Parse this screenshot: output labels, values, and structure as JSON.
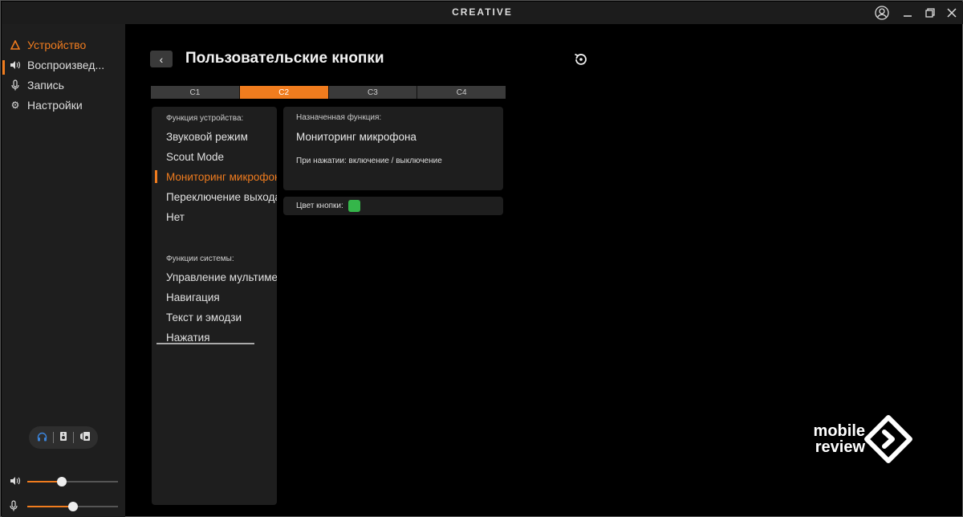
{
  "window": {
    "brand": "CREATIVE"
  },
  "sidebar": {
    "items": [
      {
        "label": "Устройство",
        "icon": "triangle-icon",
        "active": true
      },
      {
        "label": "Воспроизвед...",
        "icon": "speaker-icon",
        "active": false
      },
      {
        "label": "Запись",
        "icon": "microphone-icon",
        "active": false
      },
      {
        "label": "Настройки",
        "icon": "gear-icon",
        "active": false
      }
    ],
    "output_devices": [
      "headphones-icon",
      "speaker-box-icon",
      "speaker-box-alt-icon"
    ],
    "volume": {
      "output_level": 0.38,
      "mic_level": 0.5
    }
  },
  "main": {
    "title": "Пользовательские кнопки",
    "tabs": [
      {
        "label": "C1",
        "active": false
      },
      {
        "label": "C2",
        "active": true
      },
      {
        "label": "C3",
        "active": false
      },
      {
        "label": "C4",
        "active": false
      }
    ],
    "device_functions": {
      "header": "Функция устройства:",
      "items": [
        "Звуковой режим",
        "Scout Mode",
        "Мониторинг микрофона",
        "Переключение выхода",
        "Нет"
      ],
      "active_index": 2
    },
    "system_functions": {
      "header": "Функции системы:",
      "items": [
        "Управление мультимедиа",
        "Навигация",
        "Текст и эмодзи",
        "Нажатия"
      ]
    },
    "assigned": {
      "header": "Назначенная функция:",
      "name": "Мониторинг микрофона",
      "description": "При нажатии: включение / выключение"
    },
    "button_color": {
      "label": "Цвет кнопки:",
      "value": "#35b64a"
    }
  },
  "watermark": {
    "line1": "mobile",
    "line2": "review"
  },
  "colors": {
    "accent": "#f07c1e",
    "panel": "#1e1e1e",
    "background": "#000000"
  }
}
